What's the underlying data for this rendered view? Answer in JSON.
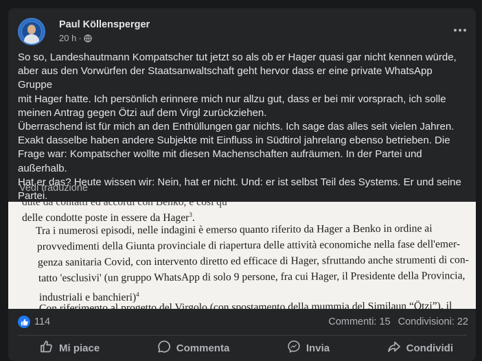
{
  "post": {
    "author": "Paul Köllensperger",
    "time": "20 h",
    "privacy_icon": "globe-icon",
    "text_lines": [
      "So so, Landeshautmann Kompatscher tut jetzt so als ob er Hager quasi gar nicht kennen würde,",
      "aber aus den Vorwürfen der Staatsanwaltschaft geht hervor dass er eine private WhatsApp Gruppe",
      "mit Hager hatte. Ich persönlich erinnere mich nur allzu gut, dass er bei mir vorsprach, ich solle",
      "meinen Antrag gegen Ötzi auf dem Virgl zurückziehen.",
      "Überraschend ist für mich an den Enthüllungen gar nichts. Ich sage das alles seit vielen Jahren.",
      "Exakt dasselbe haben andere Subjekte mit Einfluss in Südtirol jahrelang ebenso betrieben. Die",
      "Frage war: Kompatscher wollte mit diesen Machenschaften aufräumen. In der Partei und außerhalb.",
      "Hat er das? Heute wissen wir: Nein, hat er nicht. Und: er ist selbst Teil des Systems. Er und seine",
      "Partei."
    ],
    "see_translation": "Vedi traduzione"
  },
  "image_text": {
    "line0": "dute da contatti ed accordi con Benko, è così qu",
    "line1": "delle condotte poste in essere da Hager",
    "line1_sup": "3",
    "line1_end": ".",
    "line2": "Tra i numerosi episodi, nelle indagini è emerso quanto riferito da Hager a Benko in ordine ai",
    "line3": "provvedimenti della Giunta provinciale di riapertura delle attività economiche nella fase dell'emer-",
    "line4": "genza sanitaria Covid, con intervento diretto ed efficace di Hager, sfruttando anche strumenti di con-",
    "line5": "tatto 'esclusivi' (un gruppo WhatsApp di solo 9 persone, fra cui Hager, il Presidente della Provincia,",
    "line6": "industriali e banchieri)",
    "line6_sup": "4",
    "line7": "Con riferimento al progetto del Virgolo (con spostamento della mummia del Similaun “Ötzi”), il"
  },
  "stats": {
    "like_count": "114",
    "comments": "Commenti: 15",
    "shares": "Condivisioni: 22"
  },
  "actions": {
    "like": "Mi piace",
    "comment": "Commenta",
    "send": "Invia",
    "share": "Condividi"
  },
  "colors": {
    "background": "#18191a",
    "card": "#242526",
    "text": "#e4e6eb",
    "secondary": "#b0b3b8",
    "like_blue": "#2078f4"
  }
}
